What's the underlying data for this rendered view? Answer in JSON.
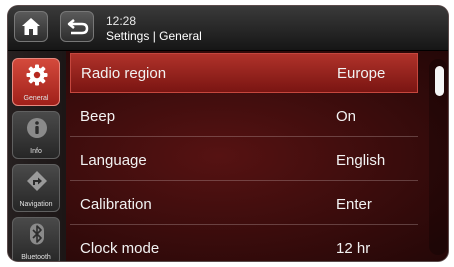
{
  "header": {
    "time": "12:28",
    "breadcrumb": "Settings | General"
  },
  "sidebar": {
    "items": [
      {
        "label": "General",
        "icon": "gear-icon",
        "active": true
      },
      {
        "label": "Info",
        "icon": "info-icon",
        "active": false
      },
      {
        "label": "Navigation",
        "icon": "navigation-icon",
        "active": false
      },
      {
        "label": "Bluetooth",
        "icon": "bluetooth-icon",
        "active": false
      }
    ]
  },
  "settings": {
    "rows": [
      {
        "label": "Radio region",
        "value": "Europe"
      },
      {
        "label": "Beep",
        "value": "On"
      },
      {
        "label": "Language",
        "value": "English"
      },
      {
        "label": "Calibration",
        "value": "Enter"
      },
      {
        "label": "Clock mode",
        "value": "12 hr"
      }
    ]
  },
  "colors": {
    "accent": "#b0322a",
    "background": "#3a0c0c",
    "text": "#f2f2f2"
  }
}
